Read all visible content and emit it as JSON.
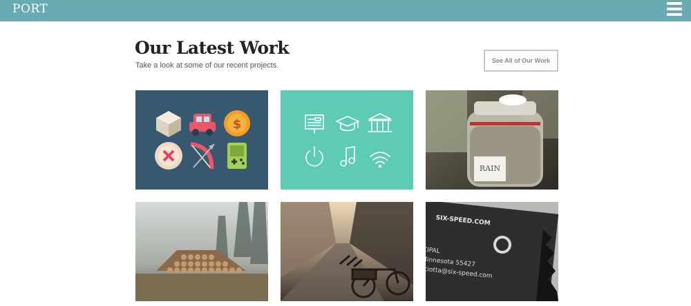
{
  "header": {
    "logo": "PORT",
    "menu_icon": "hamburger-icon",
    "bar_color": "#68aab1"
  },
  "section": {
    "title": "Our Latest Work",
    "subtitle": "Take a look at some of our recent projects.",
    "see_all_label": "See All of Our Work"
  },
  "portfolio": {
    "items": [
      {
        "name": "flat-icons-dark",
        "bg": "#37586f"
      },
      {
        "name": "line-icons-teal",
        "bg": "#5ecbb5"
      },
      {
        "name": "rain-jar-photo"
      },
      {
        "name": "log-pile-photo"
      },
      {
        "name": "bicycle-street-photo"
      },
      {
        "name": "business-card-photo"
      }
    ],
    "card_text": {
      "brand": "SIX-SPEED.COM",
      "line1": "CIPAL",
      "line2": "Minnesota 55427",
      "line3": "sciotta@six-speed.com"
    },
    "jar_label": "RAIN"
  }
}
